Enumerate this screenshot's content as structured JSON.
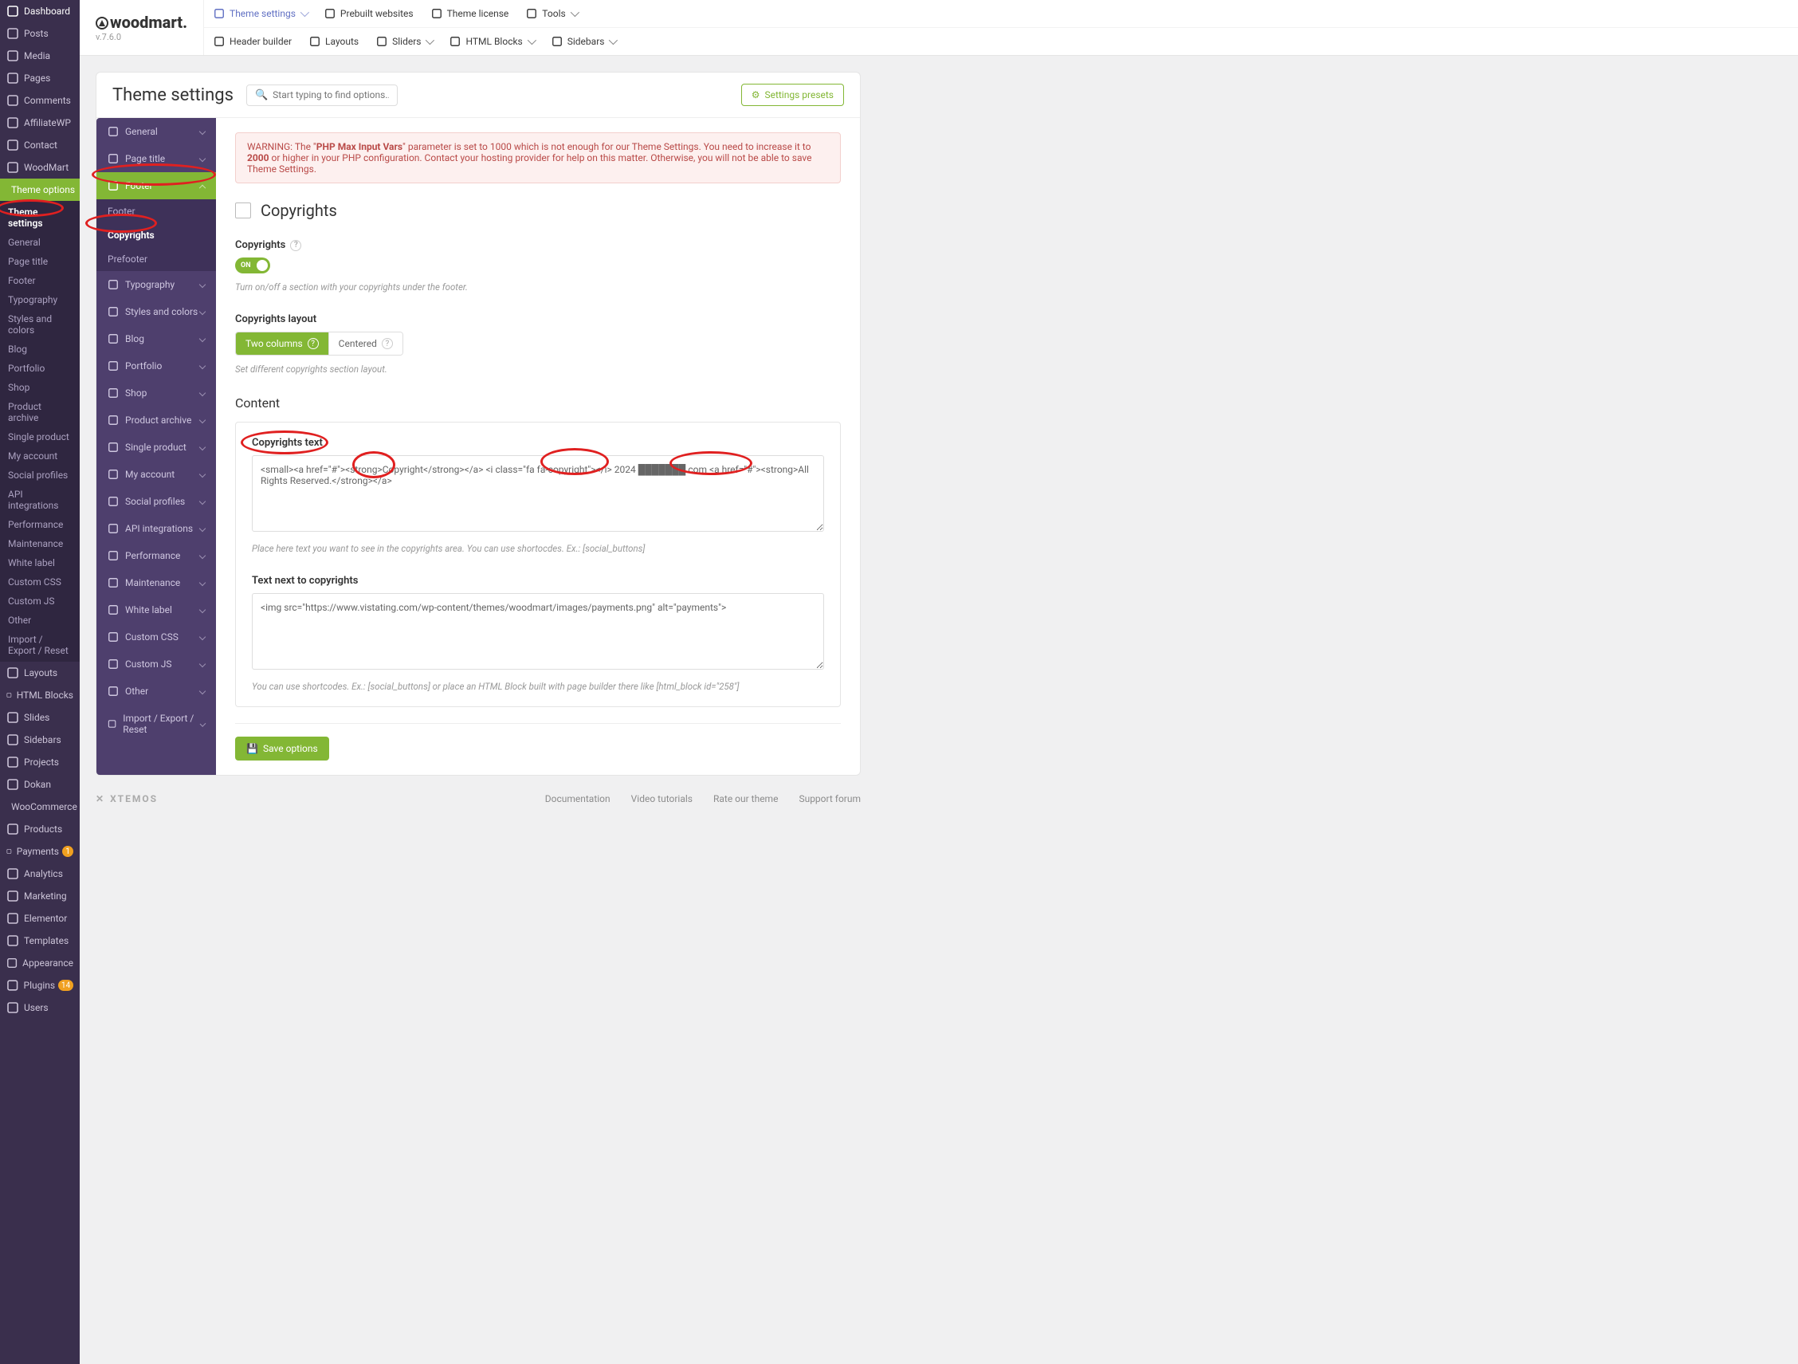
{
  "wp_sidebar": [
    {
      "icon": "dashboard",
      "label": "Dashboard"
    },
    {
      "icon": "pin",
      "label": "Posts"
    },
    {
      "icon": "media",
      "label": "Media"
    },
    {
      "icon": "page",
      "label": "Pages"
    },
    {
      "icon": "comment",
      "label": "Comments"
    },
    {
      "icon": "aff",
      "label": "AffiliateWP"
    },
    {
      "icon": "envelope",
      "label": "Contact"
    },
    {
      "icon": "woodmart",
      "label": "WoodMart"
    },
    {
      "icon": "sliders",
      "label": "Theme options",
      "active": true,
      "sub": [
        {
          "label": "Theme settings",
          "active": true
        },
        {
          "label": "General"
        },
        {
          "label": "Page title"
        },
        {
          "label": "Footer"
        },
        {
          "label": "Typography"
        },
        {
          "label": "Styles and colors"
        },
        {
          "label": "Blog"
        },
        {
          "label": "Portfolio"
        },
        {
          "label": "Shop"
        },
        {
          "label": "Product archive"
        },
        {
          "label": "Single product"
        },
        {
          "label": "My account"
        },
        {
          "label": "Social profiles"
        },
        {
          "label": "API integrations"
        },
        {
          "label": "Performance"
        },
        {
          "label": "Maintenance"
        },
        {
          "label": "White label"
        },
        {
          "label": "Custom CSS"
        },
        {
          "label": "Custom JS"
        },
        {
          "label": "Other"
        },
        {
          "label": "Import / Export / Reset"
        }
      ]
    },
    {
      "icon": "layouts-icon",
      "label": "Layouts"
    },
    {
      "icon": "htmlblocks",
      "label": "HTML Blocks"
    },
    {
      "icon": "slides",
      "label": "Slides"
    },
    {
      "icon": "sidebars",
      "label": "Sidebars"
    },
    {
      "icon": "projects",
      "label": "Projects"
    },
    {
      "icon": "dokan",
      "label": "Dokan"
    },
    {
      "icon": "woo",
      "label": "WooCommerce"
    },
    {
      "icon": "products",
      "label": "Products"
    },
    {
      "icon": "payments",
      "label": "Payments",
      "badge": "1",
      "badge_class": "orange"
    },
    {
      "icon": "analytics",
      "label": "Analytics"
    },
    {
      "icon": "marketing",
      "label": "Marketing"
    },
    {
      "icon": "elementor",
      "label": "Elementor"
    },
    {
      "icon": "templates",
      "label": "Templates"
    },
    {
      "icon": "appearance",
      "label": "Appearance"
    },
    {
      "icon": "plugins",
      "label": "Plugins",
      "badge": "14",
      "badge_class": "orange"
    },
    {
      "icon": "users",
      "label": "Users"
    }
  ],
  "brand": {
    "name": "woodmart.",
    "version": "v.7.6.0"
  },
  "toolbar_top": [
    {
      "label": "Theme settings",
      "accent": true,
      "dropdown": true,
      "icon": "sliders"
    },
    {
      "label": "Prebuilt websites",
      "icon": "grid"
    },
    {
      "label": "Theme license",
      "icon": "key"
    },
    {
      "label": "Tools",
      "dropdown": true,
      "icon": "wrench"
    }
  ],
  "toolbar_bottom": [
    {
      "label": "Header builder",
      "icon": "header"
    },
    {
      "label": "Layouts",
      "icon": "layouts"
    },
    {
      "label": "Sliders",
      "dropdown": true,
      "icon": "sliders2"
    },
    {
      "label": "HTML Blocks",
      "dropdown": true,
      "icon": "htmlb"
    },
    {
      "label": "Sidebars",
      "dropdown": true,
      "icon": "sidebars2"
    }
  ],
  "panel": {
    "title": "Theme settings",
    "search_placeholder": "Start typing to find options...",
    "presets_btn": "Settings presets"
  },
  "settings_nav": [
    {
      "label": "General",
      "icon": "home"
    },
    {
      "label": "Page title",
      "icon": "page"
    },
    {
      "label": "Footer",
      "icon": "footer",
      "active": true,
      "open": true,
      "sub": [
        {
          "label": "Footer"
        },
        {
          "label": "Copyrights",
          "active": true
        },
        {
          "label": "Prefooter"
        }
      ]
    },
    {
      "label": "Typography",
      "icon": "type"
    },
    {
      "label": "Styles and colors",
      "icon": "palette"
    },
    {
      "label": "Blog",
      "icon": "blog"
    },
    {
      "label": "Portfolio",
      "icon": "portfolio"
    },
    {
      "label": "Shop",
      "icon": "cart"
    },
    {
      "label": "Product archive",
      "icon": "archive"
    },
    {
      "label": "Single product",
      "icon": "single"
    },
    {
      "label": "My account",
      "icon": "user"
    },
    {
      "label": "Social profiles",
      "icon": "social"
    },
    {
      "label": "API integrations",
      "icon": "api"
    },
    {
      "label": "Performance",
      "icon": "perf"
    },
    {
      "label": "Maintenance",
      "icon": "maint"
    },
    {
      "label": "White label",
      "icon": "tag"
    },
    {
      "label": "Custom CSS",
      "icon": "css"
    },
    {
      "label": "Custom JS",
      "icon": "js"
    },
    {
      "label": "Other",
      "icon": "other"
    },
    {
      "label": "Import / Export / Reset",
      "icon": "io"
    }
  ],
  "alert": {
    "prefix": "WARNING: The \"",
    "bold1": "PHP Max Input Vars",
    "mid": "\" parameter is set to 1000 which is not enough for our Theme Settings. You need to increase it to ",
    "bold2": "2000",
    "suffix": " or higher in your PHP configuration. Contact your hosting provider for help on this matter. Otherwise, you will not be able to save Theme Settings."
  },
  "section": {
    "title": "Copyrights"
  },
  "fields": {
    "copyrights_toggle": {
      "label": "Copyrights",
      "on": "ON",
      "desc": "Turn on/off a section with your copyrights under the footer."
    },
    "layout": {
      "label": "Copyrights layout",
      "opt1": "Two columns",
      "opt2": "Centered",
      "desc": "Set different copyrights section layout."
    },
    "content_heading": "Content",
    "text1": {
      "label": "Copyrights text",
      "value": "<small><a href=\"#\"><strong>Copyright</strong></a> <i class=\"fa fa-copyright\"></i> 2024 ███████.com <a href=\"#\"><strong>All Rights Reserved.</strong></a>",
      "desc": "Place here text you want to see in the copyrights area. You can use shortocdes. Ex.: [social_buttons]"
    },
    "text2": {
      "label": "Text next to copyrights",
      "value": "<img src=\"https://www.vistating.com/wp-content/themes/woodmart/images/payments.png\" alt=\"payments\">",
      "desc": "You can use shortcodes. Ex.: [social_buttons] or place an HTML Block built with page builder there like [html_block id=\"258\"]"
    }
  },
  "save_btn": "Save options",
  "footer": {
    "brand": "XTEMOS",
    "links": [
      "Documentation",
      "Video tutorials",
      "Rate our theme",
      "Support forum"
    ]
  }
}
